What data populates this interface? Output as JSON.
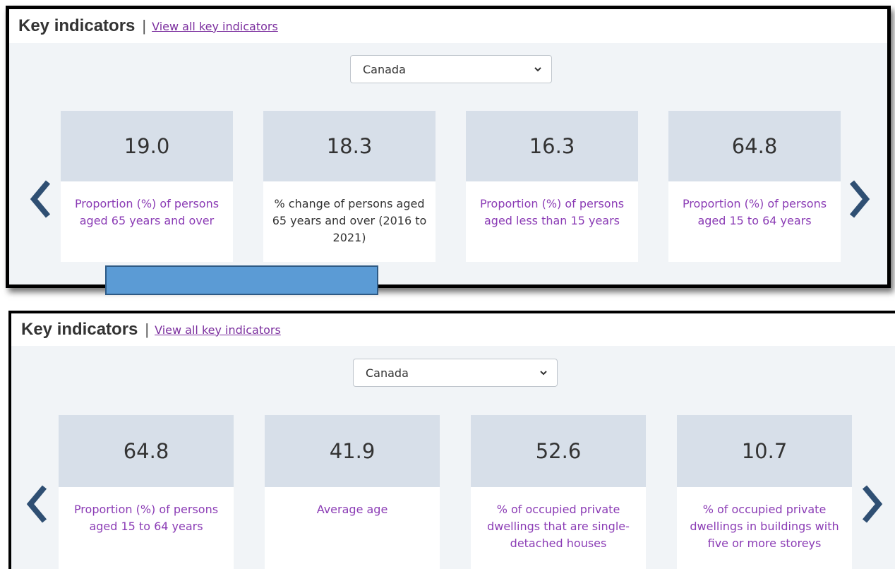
{
  "panels": [
    {
      "title": "Key indicators",
      "separator": "|",
      "link": "View all key indicators",
      "select_value": "Canada",
      "cards": [
        {
          "value": "19.0",
          "label": "Proportion (%) of persons aged 65 years and over"
        },
        {
          "value": "18.3",
          "label": "% change of persons aged 65 years and over (2016 to 2021)"
        },
        {
          "value": "16.3",
          "label": "Proportion (%) of persons aged less than 15 years"
        },
        {
          "value": "64.8",
          "label": "Proportion (%) of persons aged 15 to 64 years"
        }
      ]
    },
    {
      "title": "Key indicators",
      "separator": "|",
      "link": "View all key indicators",
      "select_value": "Canada",
      "cards": [
        {
          "value": "64.8",
          "label": "Proportion (%) of persons aged 15 to 64 years"
        },
        {
          "value": "41.9",
          "label": "Average age"
        },
        {
          "value": "52.6",
          "label": "% of occupied private dwellings that are single-detached houses"
        },
        {
          "value": "10.7",
          "label": "% of occupied private dwellings in buildings with five or more storeys"
        }
      ]
    }
  ],
  "icons": {
    "prev": "chevron-left-icon",
    "next": "chevron-right-icon",
    "dropdown": "chevron-down-icon"
  },
  "colors": {
    "link_purple": "#8b3cb5",
    "card_value_bg": "#d7dfe9",
    "panel_bg": "#f1f4f7",
    "arrow": "#2f4f73",
    "highlight_bar": "#5b9bd5"
  }
}
